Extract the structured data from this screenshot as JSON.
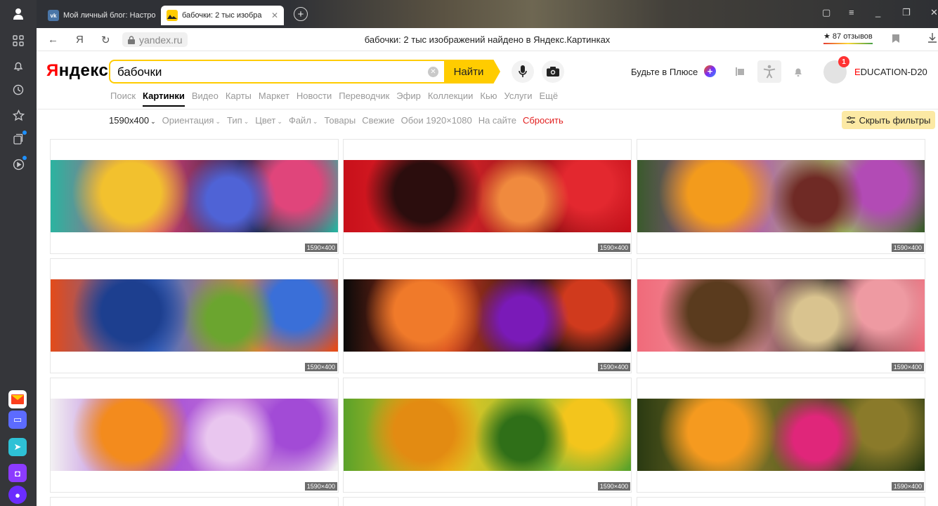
{
  "browser": {
    "tabs": [
      {
        "label": "Мой личный блог: Настро",
        "favicon": "vk-icon",
        "active": false
      },
      {
        "label": "бабочки: 2 тыс изобра",
        "favicon": "yandex-images-icon",
        "active": true
      }
    ],
    "url_host": "yandex.ru",
    "page_title": "бабочки: 2 тыс изображений найдено в Яндекс.Картинках",
    "reviews": "87 отзывов",
    "back_icon": "←",
    "ya_icon": "Я",
    "reload_icon": "↻"
  },
  "header": {
    "logo": {
      "first": "Я",
      "rest": "ндекс"
    },
    "search": {
      "value": "бабочки",
      "button": "Найти"
    },
    "plus_text": "Будьте в Плюсе",
    "notification_count": "1",
    "username": {
      "first": "E",
      "rest": "DUCATION-D20"
    }
  },
  "services": [
    "Поиск",
    "Картинки",
    "Видео",
    "Карты",
    "Маркет",
    "Новости",
    "Переводчик",
    "Эфир",
    "Коллекции",
    "Кью",
    "Услуги",
    "Ещё"
  ],
  "active_service": "Картинки",
  "filters": {
    "items": [
      {
        "label": "1590x400",
        "caret": true,
        "strong": true
      },
      {
        "label": "Ориентация",
        "caret": true
      },
      {
        "label": "Тип",
        "caret": true
      },
      {
        "label": "Цвет",
        "caret": true
      },
      {
        "label": "Файл",
        "caret": true
      },
      {
        "label": "Товары",
        "caret": false
      },
      {
        "label": "Свежие",
        "caret": false
      },
      {
        "label": "Обои 1920×1080",
        "caret": false
      },
      {
        "label": "На сайте",
        "caret": false
      },
      {
        "label": "Сбросить",
        "caret": false,
        "reset": true
      }
    ],
    "hide_label": "Скрыть фильтры"
  },
  "results": [
    {
      "size": "1590×400",
      "colors": [
        "#2bb3a0",
        "#e0457b",
        "#f2c12e",
        "#4f63d6",
        "#1b1b3a"
      ]
    },
    {
      "size": "1590×400",
      "colors": [
        "#c8101a",
        "#e3282f",
        "#2b0d0d",
        "#f08a3e",
        "#8a0f12"
      ]
    },
    {
      "size": "1590×400",
      "colors": [
        "#3a5a2c",
        "#b24bb5",
        "#f39b1c",
        "#6f2a25",
        "#a8c96a"
      ]
    },
    {
      "size": "1590×400",
      "colors": [
        "#e34b1a",
        "#3a6fd8",
        "#1d3f8f",
        "#6ba52f",
        "#e8813b"
      ]
    },
    {
      "size": "1590×400",
      "colors": [
        "#0a0a0a",
        "#d03a1d",
        "#f07a2a",
        "#7a1ab8",
        "#0f0f0f"
      ]
    },
    {
      "size": "1590×400",
      "colors": [
        "#f06a7a",
        "#ee9aa2",
        "#5a3b1e",
        "#d9c38f",
        "#1a1a1a"
      ]
    },
    {
      "size": "1590×400",
      "colors": [
        "#f2f0f2",
        "#a24bd6",
        "#f38b1d",
        "#e9c6ef",
        "#c478d8"
      ]
    },
    {
      "size": "1590×400",
      "colors": [
        "#5aa22a",
        "#f3c51c",
        "#e38b12",
        "#2f6f18",
        "#8bbf3a"
      ]
    },
    {
      "size": "1590×400",
      "colors": [
        "#2a3a12",
        "#8a7a2a",
        "#f59a1f",
        "#e0267a",
        "#3b4a1a"
      ]
    }
  ]
}
